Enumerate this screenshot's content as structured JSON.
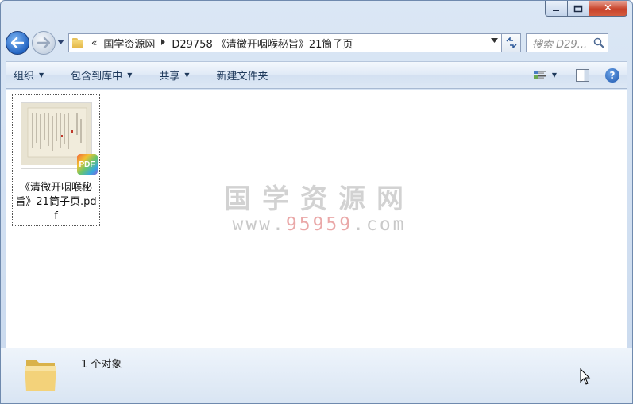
{
  "window": {
    "caption": {
      "minimize": "▭",
      "maximize": "□",
      "close": "✕"
    }
  },
  "nav": {
    "back_icon": "back-arrow-icon",
    "forward_icon": "forward-arrow-icon",
    "breadcrumb_overflow": "«",
    "breadcrumbs": [
      "国学资源网",
      "D29758 《清微开咽喉秘旨》21筒子页"
    ],
    "search_placeholder": "搜索 D29..."
  },
  "toolbar": {
    "organize": "组织",
    "include_in_library": "包含到库中",
    "share": "共享",
    "new_folder": "新建文件夹"
  },
  "files": [
    {
      "name": "《清微开咽喉秘旨》21筒子页.pdf",
      "badge": "PDF",
      "type": "pdf"
    }
  ],
  "watermark": {
    "title": "国学资源网",
    "url_prefix": "www.",
    "url_highlight": "95959",
    "url_suffix": ".com"
  },
  "status": {
    "item_count": "1 个对象"
  },
  "colors": {
    "accent": "#2466c4",
    "close_button": "#c8432b",
    "toolbar_text": "#1e395b"
  }
}
